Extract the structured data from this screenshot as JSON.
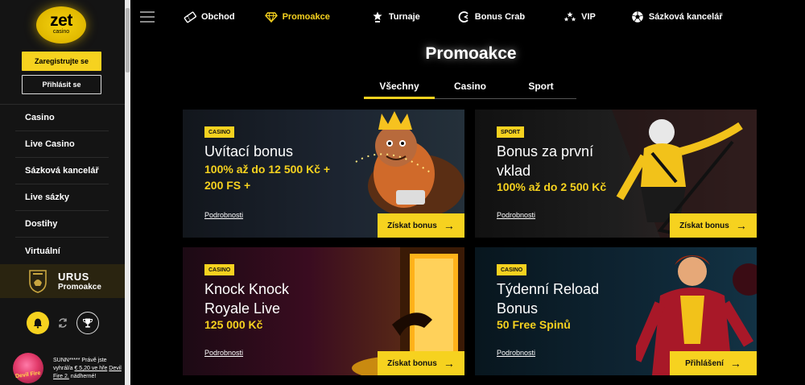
{
  "brand": {
    "logo_text": "zet",
    "logo_sub": "casino",
    "accent": "#f6d21f"
  },
  "sidebar": {
    "register": "Zaregistrujte se",
    "login": "Přihlásit se",
    "items": [
      {
        "label": "Casino"
      },
      {
        "label": "Live Casino"
      },
      {
        "label": "Sázková kancelář"
      },
      {
        "label": "Live sázky"
      },
      {
        "label": "Dostihy"
      },
      {
        "label": "Virtuální"
      }
    ],
    "promo": {
      "line1": "URUS",
      "line2": "Promoakce"
    },
    "winner": {
      "user": "SUNN*****",
      "text1": "Právě jste vyhrál/a",
      "amount": "€ 5,20 ve hře",
      "game": "Devil Fire 2.",
      "text2": "nádherné!",
      "avatar_caption": "Devil Fire"
    }
  },
  "topnav": [
    {
      "label": "Obchod",
      "icon": "ticket-icon",
      "active": false
    },
    {
      "label": "Promoakce",
      "icon": "diamond-icon",
      "active": true
    },
    {
      "label": "Turnaje",
      "icon": "trophy-star-icon",
      "active": false
    },
    {
      "label": "Bonus Crab",
      "icon": "crab-claw-icon",
      "active": false
    },
    {
      "label": "VIP",
      "icon": "stars-icon",
      "active": false
    },
    {
      "label": "Sázková kancelář",
      "icon": "football-icon",
      "active": false
    }
  ],
  "page": {
    "title": "Promoakce",
    "tabs": [
      "Všechny",
      "Casino",
      "Sport"
    ],
    "active_tab": "Všechny"
  },
  "cards": [
    {
      "badge": "CASINO",
      "title": "Uvítací bonus",
      "sub": "100% až do 12 500 Kč + 200 FS +",
      "details": "Podrobnosti",
      "cta": "Získat bonus"
    },
    {
      "badge": "SPORT",
      "title": "Bonus za první vklad",
      "sub": "100% až do 2 500 Kč",
      "details": "Podrobnosti",
      "cta": "Získat bonus"
    },
    {
      "badge": "CASINO",
      "title": "Knock Knock Royale Live",
      "sub": "125 000 Kč",
      "details": "Podrobnosti",
      "cta": "Získat bonus"
    },
    {
      "badge": "CASINO",
      "title": "Týdenní Reload Bonus",
      "sub": "50 Free Spinů",
      "details": "Podrobnosti",
      "cta": "Přihlášení"
    }
  ]
}
